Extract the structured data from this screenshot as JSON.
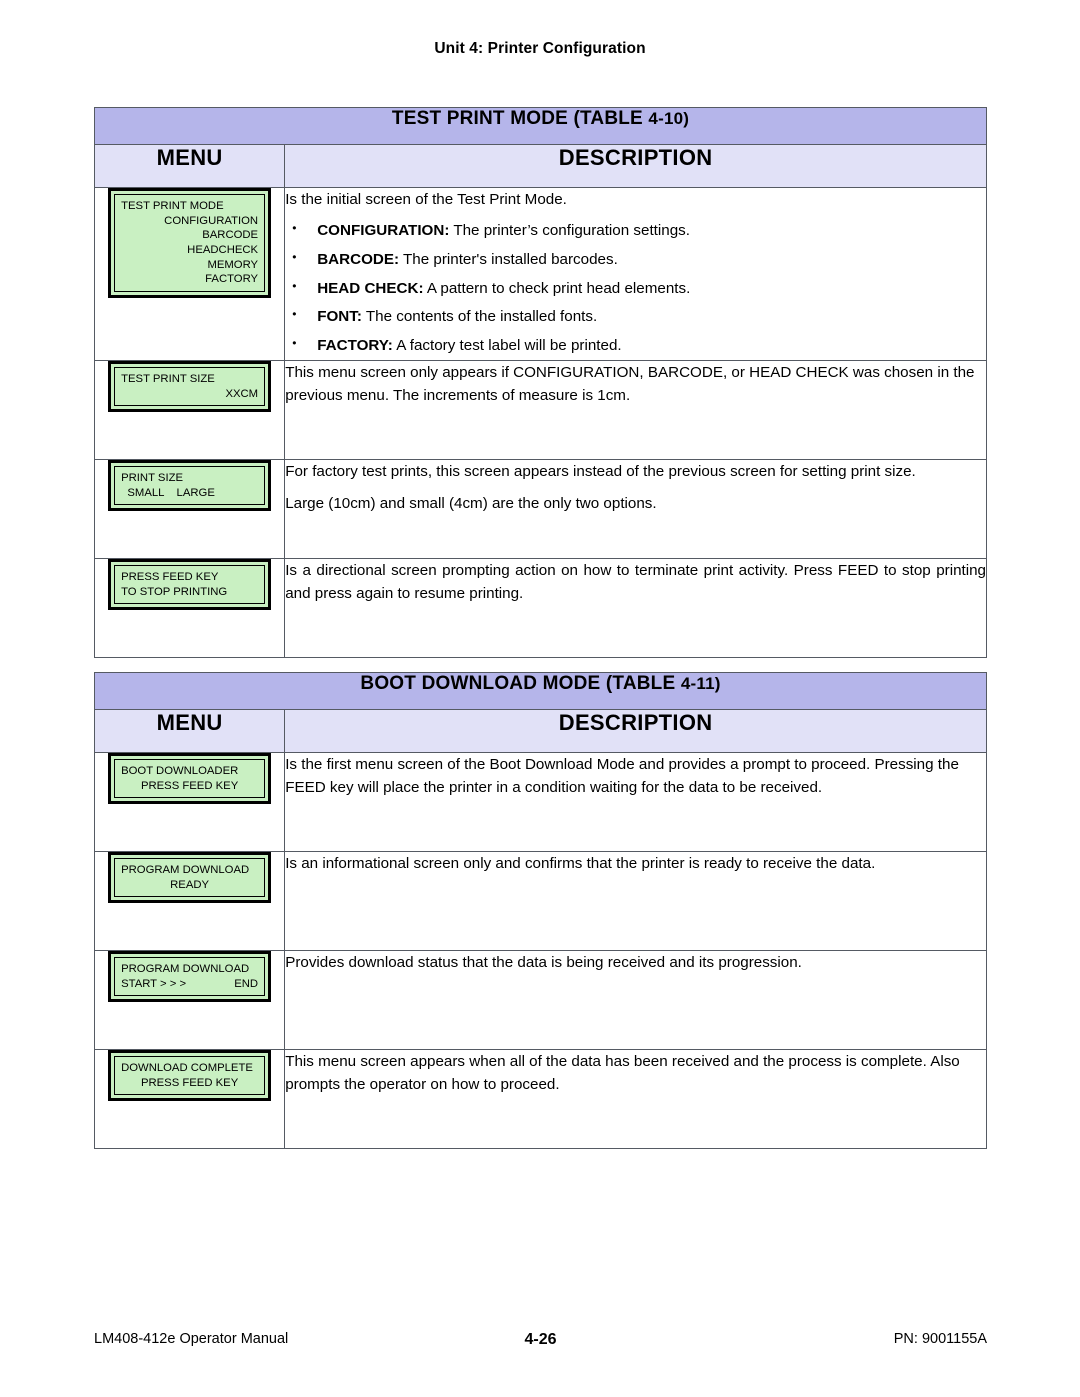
{
  "page": {
    "running_header": "Unit 4:  Printer Configuration",
    "footer_left": "LM408-412e Operator Manual",
    "footer_center": "4-26",
    "footer_right": "PN: 9001155A"
  },
  "colors": {
    "title_band": "#b5b5ea",
    "column_header": "#e1e1f7",
    "lcd_screen": "#c9f0c2",
    "border": "#555a63"
  },
  "tables": [
    {
      "title": "TEST PRINT MODE (TABLE 4-10)",
      "title_main": "TEST PRINT MODE (TABLE ",
      "title_number": "4-10)",
      "columns": {
        "menu": "MENU",
        "description": "DESCRIPTION"
      },
      "rows": [
        {
          "lcd": {
            "lines": [
              {
                "text": "TEST PRINT MODE",
                "align": "left"
              },
              {
                "text": "CONFIGURATION",
                "align": "right"
              },
              {
                "text": "BARCODE",
                "align": "right"
              },
              {
                "text": "HEADCHECK",
                "align": "right"
              },
              {
                "text": "MEMORY",
                "align": "right"
              },
              {
                "text": "FACTORY",
                "align": "right"
              }
            ]
          },
          "description": {
            "intro": "Is the initial screen of the Test Print Mode.",
            "bullets": [
              {
                "term": "CONFIGURATION:",
                "text": " The printer’s configuration settings."
              },
              {
                "term": "BARCODE:",
                "text": " The printer's installed barcodes."
              },
              {
                "term": "HEAD CHECK:",
                "text": " A pattern to check print head elements."
              },
              {
                "term": "FONT:",
                "text": " The contents of the installed fonts."
              },
              {
                "term": "FACTORY:",
                "text": " A factory test label will be printed."
              }
            ]
          }
        },
        {
          "lcd": {
            "lines": [
              {
                "text": "TEST PRINT SIZE",
                "align": "left"
              },
              {
                "text": "XXCM",
                "align": "right"
              }
            ]
          },
          "description": {
            "paragraphs": [
              "This menu screen only appears if CONFIGURATION, BARCODE, or HEAD CHECK was chosen in the previous menu. The increments of measure is 1cm."
            ]
          }
        },
        {
          "lcd": {
            "lines": [
              {
                "text": "PRINT SIZE",
                "align": "left"
              },
              {
                "text": "  SMALL    LARGE",
                "align": "left"
              }
            ]
          },
          "description": {
            "paragraphs": [
              "For factory test prints, this screen appears instead of the previous screen for setting print size.",
              "Large (10cm) and small (4cm) are the only two options."
            ]
          }
        },
        {
          "lcd": {
            "lines": [
              {
                "text": "PRESS FEED KEY",
                "align": "left"
              },
              {
                "text": "TO STOP PRINTING",
                "align": "left"
              }
            ]
          },
          "description": {
            "paragraphs": [
              "Is a directional screen prompting action on how to terminate print activity. Press FEED to stop printing and press again to resume printing."
            ]
          }
        }
      ]
    },
    {
      "title": "BOOT DOWNLOAD MODE (TABLE 4-11)",
      "title_main": "BOOT DOWNLOAD MODE (TABLE ",
      "title_number": "4-11)",
      "columns": {
        "menu": "MENU",
        "description": "DESCRIPTION"
      },
      "rows": [
        {
          "lcd": {
            "lines": [
              {
                "text": "BOOT DOWNLOADER",
                "align": "left"
              },
              {
                "text": "PRESS FEED KEY",
                "align": "center"
              }
            ]
          },
          "description": {
            "paragraphs": [
              "Is the first menu screen of the Boot Download Mode and provides a prompt to proceed. Pressing the FEED key will place the printer in a condition waiting for the data to be received."
            ]
          }
        },
        {
          "lcd": {
            "lines": [
              {
                "text": "PROGRAM DOWNLOAD",
                "align": "left"
              },
              {
                "text": "READY",
                "align": "center"
              }
            ]
          },
          "description": {
            "paragraphs": [
              "Is an informational screen only and confirms that the printer is ready to receive the data."
            ]
          }
        },
        {
          "lcd": {
            "lines": [
              {
                "text": "PROGRAM DOWNLOAD",
                "align": "left"
              },
              {
                "left": "START > > >",
                "right": "END",
                "align": "split"
              }
            ]
          },
          "description": {
            "paragraphs": [
              "Provides download status that the data is being received and its progression."
            ]
          }
        },
        {
          "lcd": {
            "lines": [
              {
                "text": "DOWNLOAD COMPLETE",
                "align": "left"
              },
              {
                "text": "PRESS FEED KEY",
                "align": "center"
              }
            ]
          },
          "description": {
            "paragraphs": [
              "This menu screen appears when all of the data has been received and the process is complete. Also prompts the operator on how to proceed."
            ]
          }
        }
      ]
    }
  ]
}
